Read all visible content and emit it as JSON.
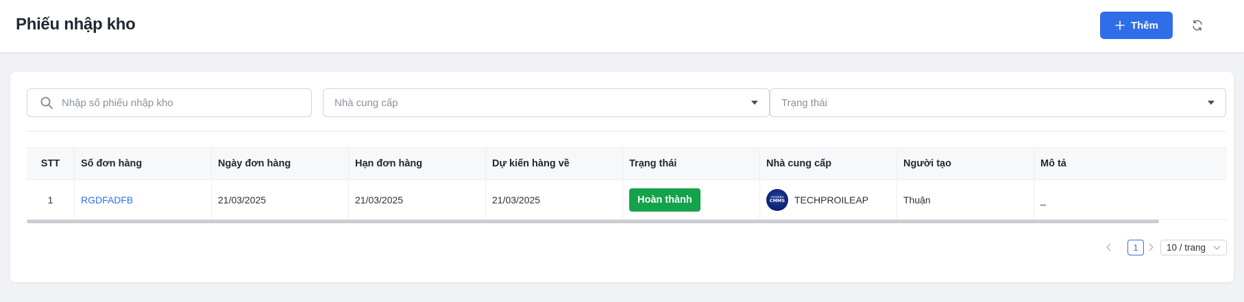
{
  "header": {
    "title": "Phiếu nhập kho",
    "add_label": "Thêm",
    "add_icon": "plus-icon",
    "refresh_icon": "refresh-icon"
  },
  "filters": {
    "search_placeholder": "Nhập số phiếu nhập kho",
    "supplier_placeholder": "Nhà cung cấp",
    "status_placeholder": "Trạng thái"
  },
  "table": {
    "columns": [
      "STT",
      "Số đơn hàng",
      "Ngày đơn hàng",
      "Hạn đơn hàng",
      "Dự kiến hàng về",
      "Trạng thái",
      "Nhà cung cấp",
      "Người tạo",
      "Mô tả"
    ],
    "rows": [
      {
        "stt": "1",
        "order_no": "RGDFADFB",
        "order_date": "21/03/2025",
        "due_date": "21/03/2025",
        "expected_date": "21/03/2025",
        "status": "Hoàn thành",
        "supplier": "TECHPROILEAP",
        "supplier_logo_text": "CMMS",
        "creator": "Thuận",
        "description": "_"
      }
    ]
  },
  "pagination": {
    "current_page": "1",
    "page_size": "10 / trang"
  },
  "colors": {
    "primary": "#2f6ee8",
    "status_done": "#13a34a",
    "background": "#f0f2f5"
  }
}
